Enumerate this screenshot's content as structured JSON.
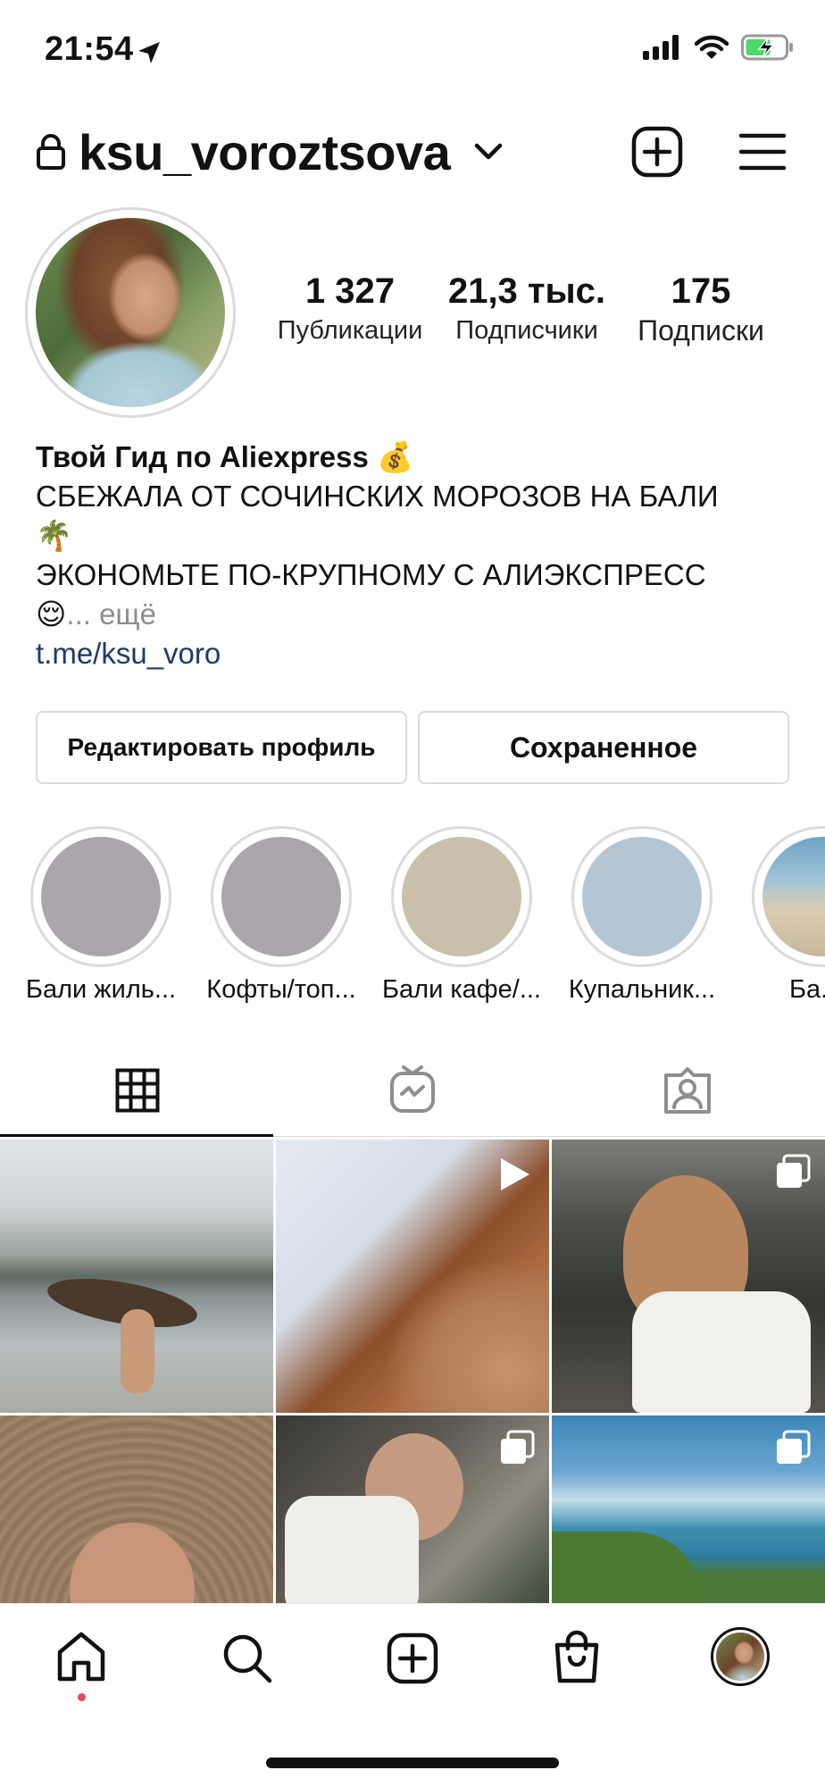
{
  "status_bar": {
    "time": "21:54"
  },
  "header": {
    "username": "ksu_voroztsova"
  },
  "stats": [
    {
      "value": "1 327",
      "label": "Публикации"
    },
    {
      "value": "21,3 тыс.",
      "label": "Подписчики"
    },
    {
      "value": "175",
      "label": "Подписки"
    }
  ],
  "bio": {
    "name": "Твой Гид по Aliexpress",
    "name_emoji": "💰",
    "line1": "СБЕЖАЛА ОТ СОЧИНСКИХ МОРОЗОВ НА БАЛИ",
    "line1_emoji": "🌴",
    "line2": "ЭКОНОМЬТЕ ПО-КРУПНОМУ С АЛИЭКСПРЕСС",
    "line2_emoji": "😌",
    "more": "... ещё",
    "link": "t.me/ksu_voro"
  },
  "buttons": {
    "edit_profile": "Редактировать профиль",
    "saved": "Сохраненное"
  },
  "highlights": [
    {
      "label": "Бали жиль...",
      "color": "#aaa6ab"
    },
    {
      "label": "Кофты/топ...",
      "color": "#aba6ab"
    },
    {
      "label": "Бали кафе/...",
      "color": "#c9bfaa"
    },
    {
      "label": "Купальник...",
      "color": "#b4c6d4"
    },
    {
      "label": "Ба...",
      "color": "#6fa3c4"
    }
  ],
  "tabs": [
    {
      "icon": "grid-icon",
      "active": true
    },
    {
      "icon": "igtv-icon",
      "active": false
    },
    {
      "icon": "tagged-icon",
      "active": false
    }
  ],
  "posts": [
    {
      "kind": "photo"
    },
    {
      "kind": "video",
      "icon": "play-icon"
    },
    {
      "kind": "carousel",
      "icon": "carousel-icon"
    },
    {
      "kind": "photo"
    },
    {
      "kind": "carousel",
      "icon": "carousel-icon"
    },
    {
      "kind": "carousel",
      "icon": "carousel-icon"
    }
  ],
  "nav": [
    "home-icon",
    "search-icon",
    "new-post-icon",
    "shop-icon",
    "profile-avatar"
  ],
  "colors": {
    "link": "#1e3a6b",
    "border": "#dbdbdb",
    "notification_dot": "#ed4956"
  }
}
